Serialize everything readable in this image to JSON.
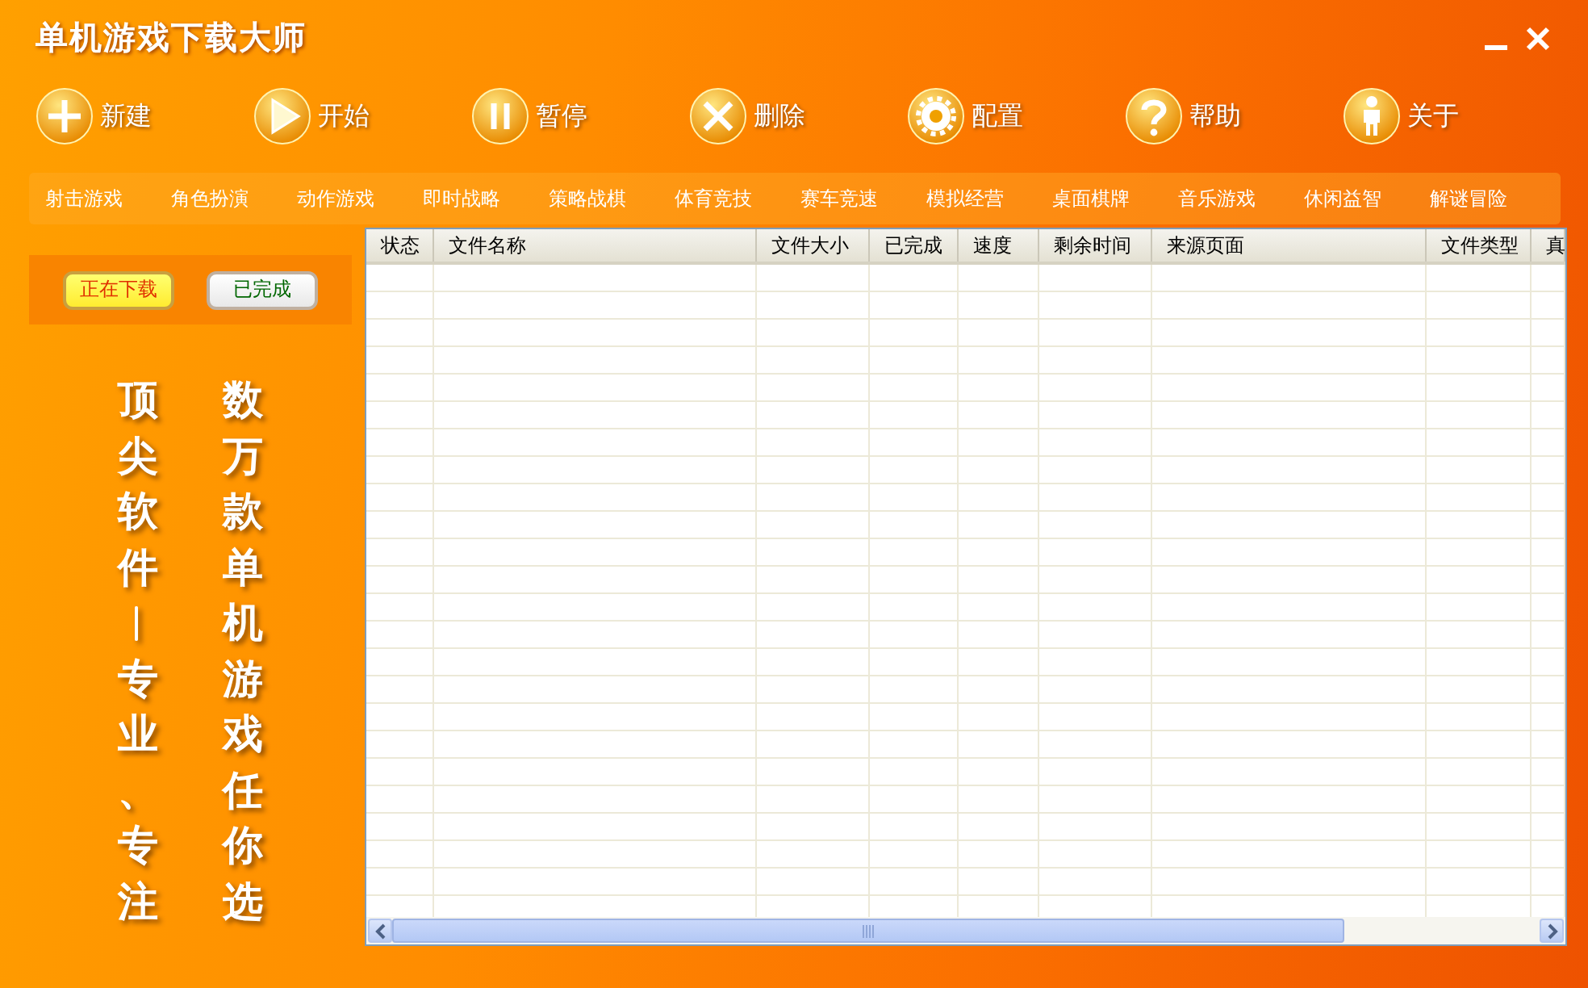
{
  "window": {
    "title": "单机游戏下载大师",
    "controls": [
      {
        "kind": "minimize"
      },
      {
        "kind": "close"
      }
    ]
  },
  "toolbar": [
    {
      "kind": "new",
      "label": "新建"
    },
    {
      "kind": "start",
      "label": "开始"
    },
    {
      "kind": "pause",
      "label": "暂停"
    },
    {
      "kind": "delete",
      "label": "删除"
    },
    {
      "kind": "settings",
      "label": "配置"
    },
    {
      "kind": "help",
      "label": "帮助"
    },
    {
      "kind": "about",
      "label": "关于"
    }
  ],
  "categories": [
    "射击游戏",
    "角色扮演",
    "动作游戏",
    "即时战略",
    "策略战棋",
    "体育竞技",
    "赛车竞速",
    "模拟经营",
    "桌面棋牌",
    "音乐游戏",
    "休闲益智",
    "解谜冒险"
  ],
  "download_tabs": [
    {
      "label": "正在下载",
      "selected": true
    },
    {
      "label": "已完成",
      "selected": false
    }
  ],
  "slogan": [
    "顶尖软件︱专业、专注",
    "数万款单机游戏任你选"
  ],
  "table": {
    "columns": [
      "状态",
      "文件名称",
      "文件大小",
      "已完成",
      "速度",
      "剩余时间",
      "来源页面",
      "文件类型",
      "真"
    ]
  }
}
